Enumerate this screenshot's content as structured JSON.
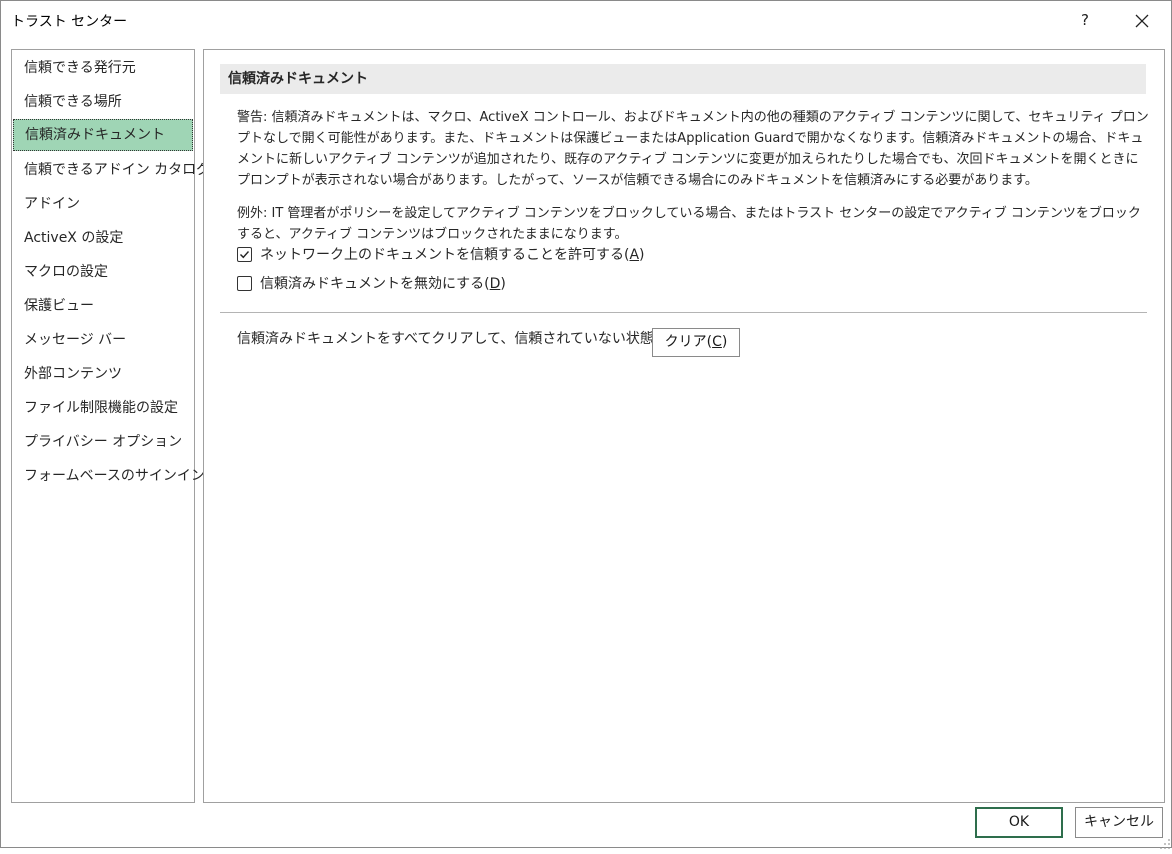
{
  "window": {
    "title": "トラスト センター",
    "help_label": "?"
  },
  "sidebar": {
    "items": [
      {
        "label": "信頼できる発行元"
      },
      {
        "label": "信頼できる場所"
      },
      {
        "label": "信頼済みドキュメント",
        "selected": true
      },
      {
        "label": "信頼できるアドイン カタログ"
      },
      {
        "label": "アドイン"
      },
      {
        "label": "ActiveX の設定"
      },
      {
        "label": "マクロの設定"
      },
      {
        "label": "保護ビュー"
      },
      {
        "label": "メッセージ バー"
      },
      {
        "label": "外部コンテンツ"
      },
      {
        "label": "ファイル制限機能の設定"
      },
      {
        "label": "プライバシー オプション"
      },
      {
        "label": "フォームベースのサインイン"
      }
    ]
  },
  "main": {
    "header": "信頼済みドキュメント",
    "warning": "警告: 信頼済みドキュメントは、マクロ、ActiveX コントロール、およびドキュメント内の他の種類のアクティブ コンテンツに関して、セキュリティ プロンプトなしで開く可能性があります。また、ドキュメントは保護ビューまたはApplication Guardで開かなくなります。信頼済みドキュメントの場合、ドキュメントに新しいアクティブ コンテンツが追加されたり、既存のアクティブ コンテンツに変更が加えられたりした場合でも、次回ドキュメントを開くときにプロンプトが表示されない場合があります。したがって、ソースが信頼できる場合にのみドキュメントを信頼済みにする必要があります。",
    "exception": "例外: IT 管理者がポリシーを設定してアクティブ コンテンツをブロックしている場合、またはトラスト センターの設定でアクティブ コンテンツをブロックすると、アクティブ コンテンツはブロックされたままになります。",
    "allow_network": {
      "label_text": "ネットワーク上のドキュメントを信頼することを許可する(",
      "label_key": "A",
      "label_end": ")",
      "checked": true
    },
    "disable_trusted": {
      "label_text": "信頼済みドキュメントを無効にする(",
      "label_key": "D",
      "label_end": ")",
      "checked": false
    },
    "clear_text": "信頼済みドキュメントをすべてクリアして、信頼されていない状態にする",
    "clear_button": {
      "label_text": "クリア(",
      "label_key": "C",
      "label_end": ")"
    }
  },
  "footer": {
    "ok_label": "OK",
    "cancel_label": "キャンセル"
  },
  "colors": {
    "selected_bg": "#9fd5b5",
    "header_bg": "#ebebeb",
    "ok_border": "#2e6e4c"
  }
}
